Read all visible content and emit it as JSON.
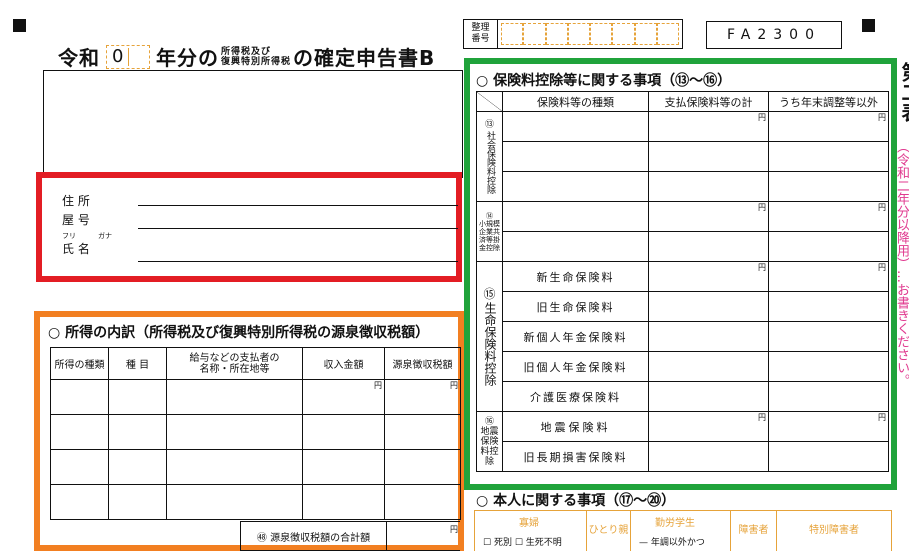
{
  "header": {
    "era": "令和",
    "year_value": "0",
    "year_suffix": "年分の",
    "tax_small_line1": "所得税及び",
    "tax_small_line2": "復興特別所得税",
    "form_title": "の確定申告書B",
    "seiri_label_1": "整理",
    "seiri_label_2": "番号",
    "form_code": "FA2300"
  },
  "address": {
    "jusho": "住 所",
    "yago": "屋 号",
    "furi": "フリ",
    "gana": "ガナ",
    "shimei": "氏 名"
  },
  "income": {
    "section_title": "○ 所得の内訳（所得税及び復興特別所得税の源泉徴収税額）",
    "headers": [
      "所得の種類",
      "種 目",
      "給与などの支払者の\n名称・所在地等",
      "収入金額",
      "源泉徴収税額"
    ],
    "yen": "円",
    "total_label": "㊽ 源泉徴収税額の合計額",
    "rows": 4
  },
  "insurance": {
    "section_title": "○ 保険料控除等に関する事項（⑬〜⑯）",
    "headers": [
      "保険料等の種類",
      "支払保険料等の計",
      "うち年末調整等以外"
    ],
    "yen": "円",
    "groups": [
      {
        "code": "⑬",
        "label": "社会保険料控除",
        "rows": [
          "",
          "",
          ""
        ]
      },
      {
        "code": "⑭",
        "label": "小規模企業共済等掛金控除",
        "rows": [
          "",
          ""
        ]
      },
      {
        "code": "⑮",
        "label": "生命保険料控除",
        "rows": [
          "新生命保険料",
          "旧生命保険料",
          "新個人年金保険料",
          "旧個人年金保険料",
          "介護医療保険料"
        ]
      },
      {
        "code": "⑯",
        "label": "地震保険料控除",
        "rows": [
          "地震保険料",
          "旧長期損害保険料"
        ]
      }
    ]
  },
  "personal": {
    "section_title": "○ 本人に関する事項（⑰〜⑳）",
    "items": [
      "寡婦",
      "ひとり親",
      "勤労学生",
      "障害者",
      "特別障害者"
    ],
    "sub_items": [
      "死別",
      "生死不明",
      "年調以外かつ"
    ]
  },
  "side_text": "第二表",
  "pink_side": "（令和二年分以降用）…お書きください。",
  "colors": {
    "red": "#e31d24",
    "orange": "#f27f21",
    "green": "#20a33b",
    "pink": "#e03a8f"
  }
}
